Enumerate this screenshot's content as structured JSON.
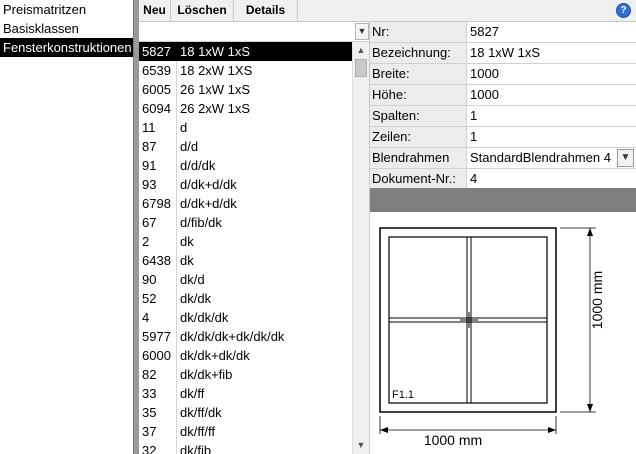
{
  "nav": {
    "items": [
      {
        "label": "Preismatritzen",
        "selected": false
      },
      {
        "label": "Basisklassen",
        "selected": false
      },
      {
        "label": "Fensterkonstruktionen",
        "selected": true
      }
    ]
  },
  "toolbar": {
    "new_label": "Neu",
    "delete_label": "Löschen",
    "details_label": "Details",
    "help_icon": "?"
  },
  "list": {
    "filter_value": "",
    "rows": [
      {
        "nr": "5827",
        "bez": "18 1xW 1xS",
        "selected": true
      },
      {
        "nr": "6539",
        "bez": "18 2xW 1XS"
      },
      {
        "nr": "6005",
        "bez": "26 1xW 1xS"
      },
      {
        "nr": "6094",
        "bez": "26 2xW 1xS"
      },
      {
        "nr": "11",
        "bez": "d"
      },
      {
        "nr": "87",
        "bez": "d/d"
      },
      {
        "nr": "91",
        "bez": "d/d/dk"
      },
      {
        "nr": "93",
        "bez": "d/dk+d/dk"
      },
      {
        "nr": "6798",
        "bez": "d/dk+d/dk"
      },
      {
        "nr": "67",
        "bez": "d/fib/dk"
      },
      {
        "nr": "2",
        "bez": "dk"
      },
      {
        "nr": "6438",
        "bez": "dk"
      },
      {
        "nr": "90",
        "bez": "dk/d"
      },
      {
        "nr": "52",
        "bez": "dk/dk"
      },
      {
        "nr": "4",
        "bez": "dk/dk/dk"
      },
      {
        "nr": "5977",
        "bez": "dk/dk/dk+dk/dk/dk"
      },
      {
        "nr": "6000",
        "bez": "dk/dk+dk/dk"
      },
      {
        "nr": "82",
        "bez": "dk/dk+fib"
      },
      {
        "nr": "33",
        "bez": "dk/ff"
      },
      {
        "nr": "35",
        "bez": "dk/ff/dk"
      },
      {
        "nr": "37",
        "bez": "dk/ff/ff"
      },
      {
        "nr": "32",
        "bez": "dk/fib"
      }
    ],
    "scroll_up_icon": "▲",
    "scroll_down_icon": "▼",
    "dropdown_icon": "▼"
  },
  "props": {
    "nr_label": "Nr:",
    "nr_value": "5827",
    "bez_label": "Bezeichnung:",
    "bez_value": "18 1xW 1xS",
    "breite_label": "Breite:",
    "breite_value": "1000",
    "hoehe_label": "Höhe:",
    "hoehe_value": "1000",
    "spalten_label": "Spalten:",
    "spalten_value": "1",
    "zeilen_label": "Zeilen:",
    "zeilen_value": "1",
    "blend_label": "Blendrahmen",
    "blend_value": "StandardBlendrahmen 4",
    "dok_label": "Dokument-Nr.:",
    "dok_value": "4"
  },
  "drawing": {
    "width_dim": "1000 mm",
    "height_dim": "1000 mm",
    "position_label": "F1.1"
  },
  "colors": {
    "selection": "#000000",
    "splitter": "#9a9a9a",
    "header_bar": "#7f7f7f",
    "help_icon": "#2f6fd6"
  }
}
